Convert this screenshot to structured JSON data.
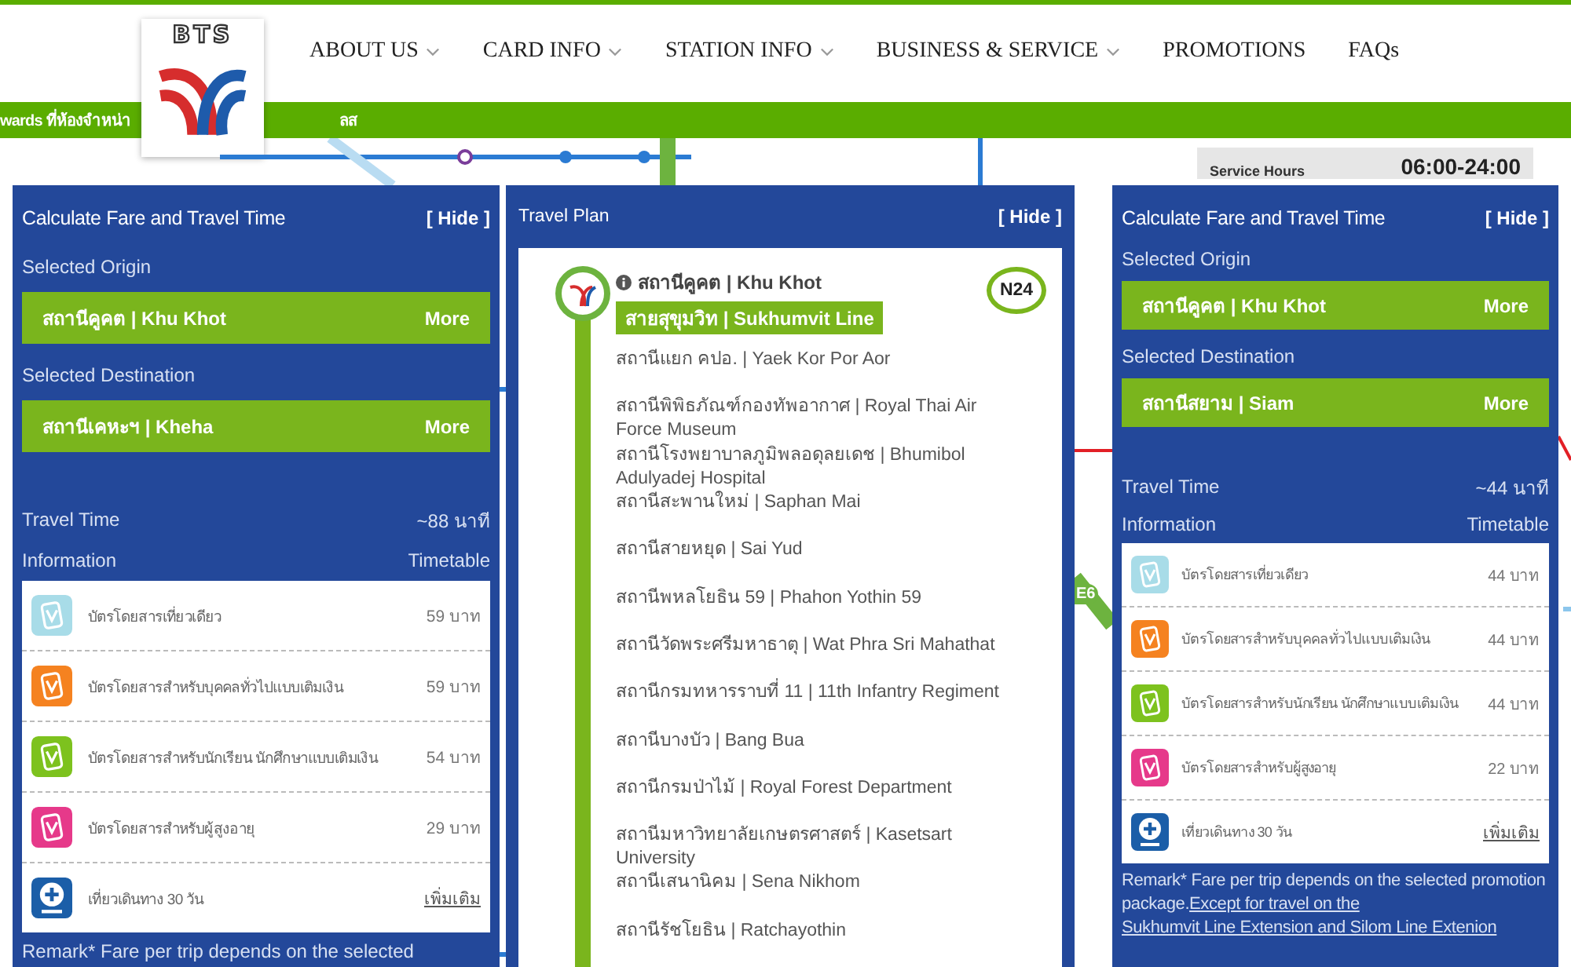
{
  "header": {
    "logo_text": "BTS",
    "nav": [
      {
        "label": "ABOUT US",
        "dropdown": true
      },
      {
        "label": "CARD INFO",
        "dropdown": true
      },
      {
        "label": "STATION INFO",
        "dropdown": true
      },
      {
        "label": "BUSINESS & SERVICE",
        "dropdown": true
      },
      {
        "label": "PROMOTIONS",
        "dropdown": false
      },
      {
        "label": "FAQs",
        "dropdown": false
      }
    ]
  },
  "banner": {
    "text_before": "wards ที่ห้องจำหน่า",
    "text_after": "ลส"
  },
  "map": {
    "service_hours_label": "Service Hours",
    "service_hours": "06:00-24:00",
    "station_code": "E6"
  },
  "panels": [
    {
      "kind": "fare",
      "title": "Calculate Fare and Travel Time",
      "hide": "[ Hide ]",
      "origin_label": "Selected Origin",
      "origin": "สถานีคูคต | Khu Khot",
      "origin_more": "More",
      "destination_label": "Selected Destination",
      "destination": "สถานีเคหะฯ | Kheha",
      "destination_more": "More",
      "travel_time_label": "Travel Time",
      "travel_time": "~88 นาที",
      "info_label": "Information",
      "timetable": "Timetable",
      "fares": [
        {
          "kind": "card",
          "color": "#a8dce8",
          "name": "บัตรโดยสารเที่ยวเดียว",
          "price": "59 บาท"
        },
        {
          "kind": "card",
          "color": "#f58220",
          "name": "บัตรโดยสารสำหรับบุคคลทั่วไปแบบเติมเงิน",
          "price": "59 บาท"
        },
        {
          "kind": "card",
          "color": "#7dc21e",
          "name": "บัตรโดยสารสำหรับนักเรียน นักศึกษาแบบเติมเงิน",
          "price": "54 บาท"
        },
        {
          "kind": "card",
          "color": "#e6398a",
          "name": "บัตรโดยสารสำหรับผู้สูงอายุ",
          "price": "29 บาท"
        },
        {
          "kind": "trips",
          "color": "#1b5ea8",
          "name": "เที่ยวเดินทาง 30 วัน",
          "link": "เพิ่มเติม"
        }
      ],
      "remark": "Remark* Fare per trip depends on the selected"
    },
    {
      "kind": "plan",
      "title": "Travel Plan",
      "hide": "[ Hide ]",
      "origin": "สถานีคูคต | Khu Khot",
      "line": "สายสุขุมวิท | Sukhumvit Line",
      "code": "N24",
      "stations": [
        "สถานีแยก คปอ. | Yaek Kor Por Aor",
        "สถานีพิพิธภัณฑ์กองทัพอากาศ | Royal Thai Air Force Museum",
        "สถานีโรงพยาบาลภูมิพลอดุลยเดช | Bhumibol Adulyadej Hospital",
        "สถานีสะพานใหม่ | Saphan Mai",
        "สถานีสายหยุด | Sai Yud",
        "สถานีพหลโยธิน 59 | Phahon Yothin 59",
        "สถานีวัดพระศรีมหาธาตุ | Wat Phra Sri Mahathat",
        "สถานีกรมทหารราบที่ 11 | 11th Infantry Regiment",
        "สถานีบางบัว | Bang Bua",
        "สถานีกรมป่าไม้ | Royal Forest Department",
        "สถานีมหาวิทยาลัยเกษตรศาสตร์ | Kasetsart University",
        "สถานีเสนานิคม | Sena Nikhom",
        "สถานีรัชโยธิน | Ratchayothin"
      ]
    },
    {
      "kind": "fare",
      "title": "Calculate Fare and Travel Time",
      "hide": "[ Hide ]",
      "origin_label": "Selected Origin",
      "origin": "สถานีคูคต | Khu Khot",
      "origin_more": "More",
      "destination_label": "Selected Destination",
      "destination": "สถานีสยาม | Siam",
      "destination_more": "More",
      "travel_time_label": "Travel Time",
      "travel_time": "~44 นาที",
      "info_label": "Information",
      "timetable": "Timetable",
      "fares": [
        {
          "kind": "card",
          "color": "#a8dce8",
          "name": "บัตรโดยสารเที่ยวเดียว",
          "price": "44 บาท"
        },
        {
          "kind": "card",
          "color": "#f58220",
          "name": "บัตรโดยสารสำหรับบุคคลทั่วไปแบบเติมเงิน",
          "price": "44 บาท"
        },
        {
          "kind": "card",
          "color": "#7dc21e",
          "name": "บัตรโดยสารสำหรับนักเรียน นักศึกษาแบบเติมเงิน",
          "price": "44 บาท"
        },
        {
          "kind": "card",
          "color": "#e6398a",
          "name": "บัตรโดยสารสำหรับผู้สูงอายุ",
          "price": "22 บาท"
        },
        {
          "kind": "trips",
          "color": "#1b5ea8",
          "name": "เที่ยวเดินทาง 30 วัน",
          "link": "เพิ่มเติม"
        }
      ],
      "remark": "Remark* Fare per trip depends on the selected promotion package.",
      "link_lines": [
        "Except for travel on the",
        "Sukhumvit Line Extension and Silom Line Extenion"
      ]
    }
  ]
}
